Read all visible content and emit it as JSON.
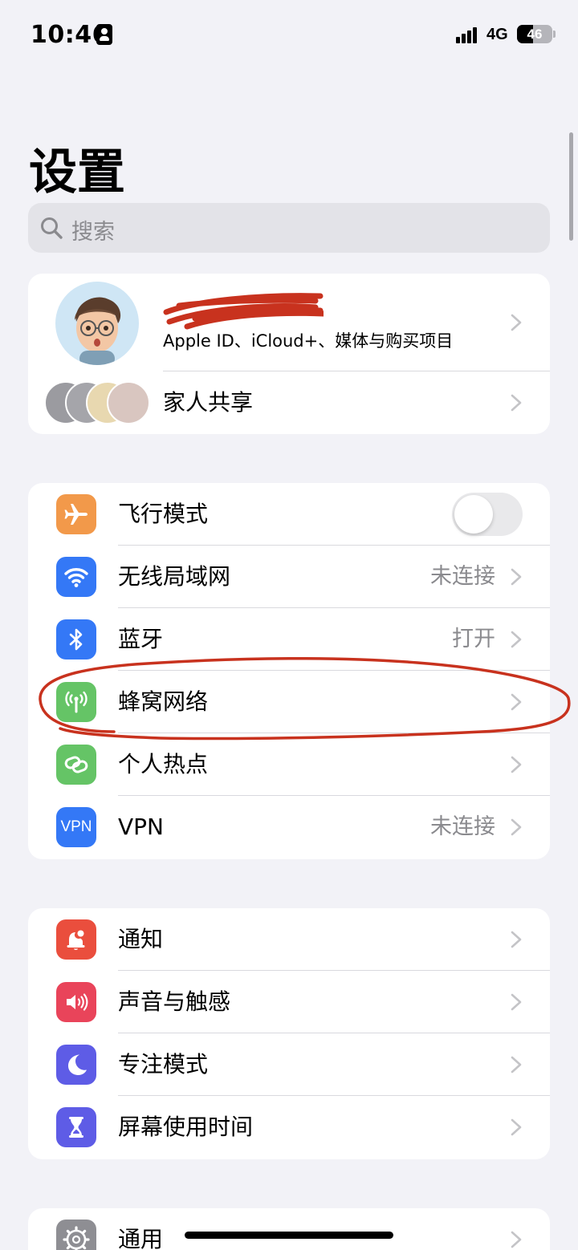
{
  "status_bar": {
    "time": "10:46",
    "network": "4G",
    "battery_percent": "46",
    "battery_level": 0.46,
    "person_icon": "person-card-icon",
    "signal_icon": "signal-bars-icon"
  },
  "title": "设置",
  "search": {
    "placeholder": "搜索",
    "icon": "search-icon"
  },
  "account": {
    "name": "",
    "subtitle": "Apple ID、iCloud+、媒体与购买项目",
    "family_label": "家人共享"
  },
  "connectivity": [
    {
      "label": "飞行模式",
      "icon": "airplane-icon",
      "color": "#f2994a",
      "control": "toggle",
      "toggle_on": false
    },
    {
      "label": "无线局域网",
      "icon": "wifi-icon",
      "color": "#3478f6",
      "value": "未连接"
    },
    {
      "label": "蓝牙",
      "icon": "bluetooth-icon",
      "color": "#3478f6",
      "value": "打开"
    },
    {
      "label": "蜂窝网络",
      "icon": "antenna-icon",
      "color": "#65c466",
      "value": ""
    },
    {
      "label": "个人热点",
      "icon": "hotspot-chain-icon",
      "color": "#65c466",
      "value": ""
    },
    {
      "label": "VPN",
      "icon": "vpn-icon",
      "icon_text": "VPN",
      "color": "#3478f6",
      "value": "未连接"
    }
  ],
  "attention": [
    {
      "label": "通知",
      "icon": "bell-icon",
      "color": "#ea4e3d"
    },
    {
      "label": "声音与触感",
      "icon": "speaker-icon",
      "color": "#e9445a"
    },
    {
      "label": "专注模式",
      "icon": "moon-icon",
      "color": "#5e5ce6"
    },
    {
      "label": "屏幕使用时间",
      "icon": "hourglass-icon",
      "color": "#5e5ce6"
    }
  ],
  "general": [
    {
      "label": "通用",
      "icon": "gear-icon",
      "color": "#8e8e93"
    }
  ],
  "colors": {
    "background": "#f2f2f7",
    "annotation_red": "#c8321e"
  }
}
